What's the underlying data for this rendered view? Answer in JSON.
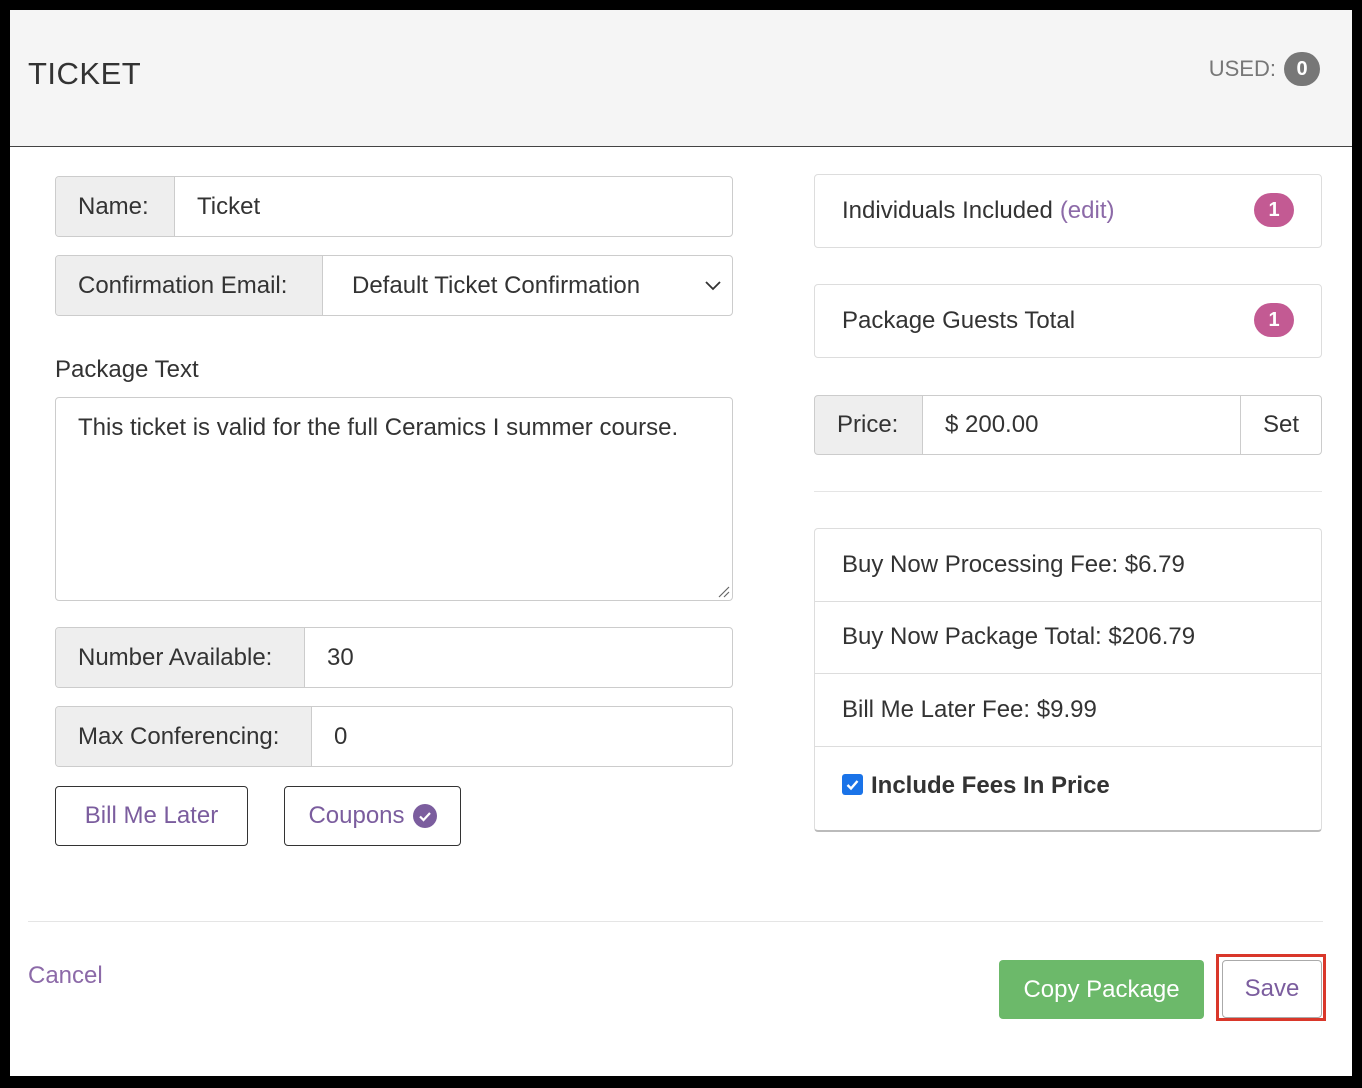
{
  "header": {
    "title": "TICKET",
    "used_label": "USED:",
    "used_count": "0"
  },
  "form": {
    "name_label": "Name:",
    "name_value": "Ticket",
    "confirmation_label": "Confirmation Email:",
    "confirmation_value": "Default Ticket Confirmation",
    "package_text_label": "Package Text",
    "package_text_value": "This ticket is valid for the full Ceramics I summer course.",
    "number_available_label": "Number Available:",
    "number_available_value": "30",
    "max_conferencing_label": "Max Conferencing:",
    "max_conferencing_value": "0",
    "bill_me_later_button": "Bill Me Later",
    "coupons_button": "Coupons"
  },
  "right": {
    "individuals_label": "Individuals Included",
    "individuals_edit": "(edit)",
    "individuals_count": "1",
    "guests_label": "Package Guests Total",
    "guests_count": "1",
    "price_label": "Price:",
    "price_value": "$ 200.00",
    "set_button": "Set",
    "fees": {
      "processing_fee": "Buy Now Processing Fee: $6.79",
      "package_total": "Buy Now Package Total: $206.79",
      "bill_later_fee": "Bill Me Later Fee: $9.99",
      "include_fees_label": "Include Fees In Price"
    }
  },
  "footer": {
    "cancel": "Cancel",
    "copy_package": "Copy Package",
    "save": "Save"
  },
  "colors": {
    "accent": "#8c6aa8",
    "badge": "#c35a93",
    "green": "#6cb96a",
    "highlight": "#d9372a",
    "checkbox": "#1a73e8"
  }
}
